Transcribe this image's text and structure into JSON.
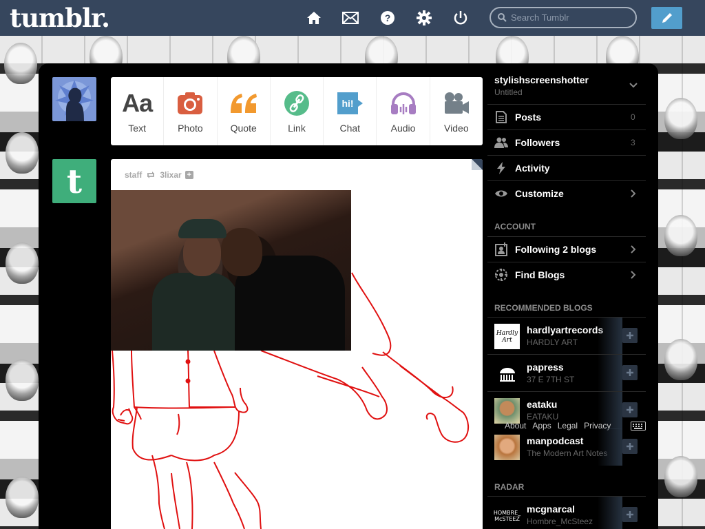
{
  "header": {
    "logo": "tumblr.",
    "search_placeholder": "Search Tumblr",
    "nav": [
      "home-icon",
      "inbox-icon",
      "help-icon",
      "settings-icon",
      "power-icon"
    ],
    "compose_icon": "pencil-icon"
  },
  "post_types": [
    {
      "label": "Text",
      "icon": "text-icon",
      "color": "#444444"
    },
    {
      "label": "Photo",
      "icon": "camera-icon",
      "color": "#d95e40"
    },
    {
      "label": "Quote",
      "icon": "quote-icon",
      "color": "#f2992e"
    },
    {
      "label": "Link",
      "icon": "link-icon",
      "color": "#56bc8a"
    },
    {
      "label": "Chat",
      "icon": "chat-icon",
      "color": "#529ecc"
    },
    {
      "label": "Audio",
      "icon": "headphones-icon",
      "color": "#a77dc2"
    },
    {
      "label": "Video",
      "icon": "video-camera-icon",
      "color": "#748089"
    }
  ],
  "post": {
    "author": "staff",
    "reblogged_from": "3lixar"
  },
  "sidebar": {
    "blog_name": "stylishscreenshotter",
    "blog_title": "Untitled",
    "stats": [
      {
        "label": "Posts",
        "count": "0",
        "icon": "document-icon"
      },
      {
        "label": "Followers",
        "count": "3",
        "icon": "people-icon"
      },
      {
        "label": "Activity",
        "count": "",
        "icon": "lightning-icon"
      },
      {
        "label": "Customize",
        "count": "",
        "icon": "eye-icon"
      }
    ],
    "account_heading": "ACCOUNT",
    "account": [
      {
        "label": "Following 2 blogs",
        "icon": "following-icon"
      },
      {
        "label": "Find Blogs",
        "icon": "compass-icon"
      }
    ],
    "recommended_heading": "RECOMMENDED BLOGS",
    "recommended": [
      {
        "name": "hardlyartrecords",
        "title": "HARDLY ART"
      },
      {
        "name": "papress",
        "title": "37 E 7TH ST"
      },
      {
        "name": "eataku",
        "title": "EATAKU"
      },
      {
        "name": "manpodcast",
        "title": "The Modern Art Notes"
      }
    ],
    "footer_links": [
      "About",
      "Apps",
      "Legal",
      "Privacy"
    ],
    "radar_heading": "RADAR",
    "radar": [
      {
        "name": "mcgnarcal",
        "title": "Hombre_McSteez"
      }
    ]
  }
}
